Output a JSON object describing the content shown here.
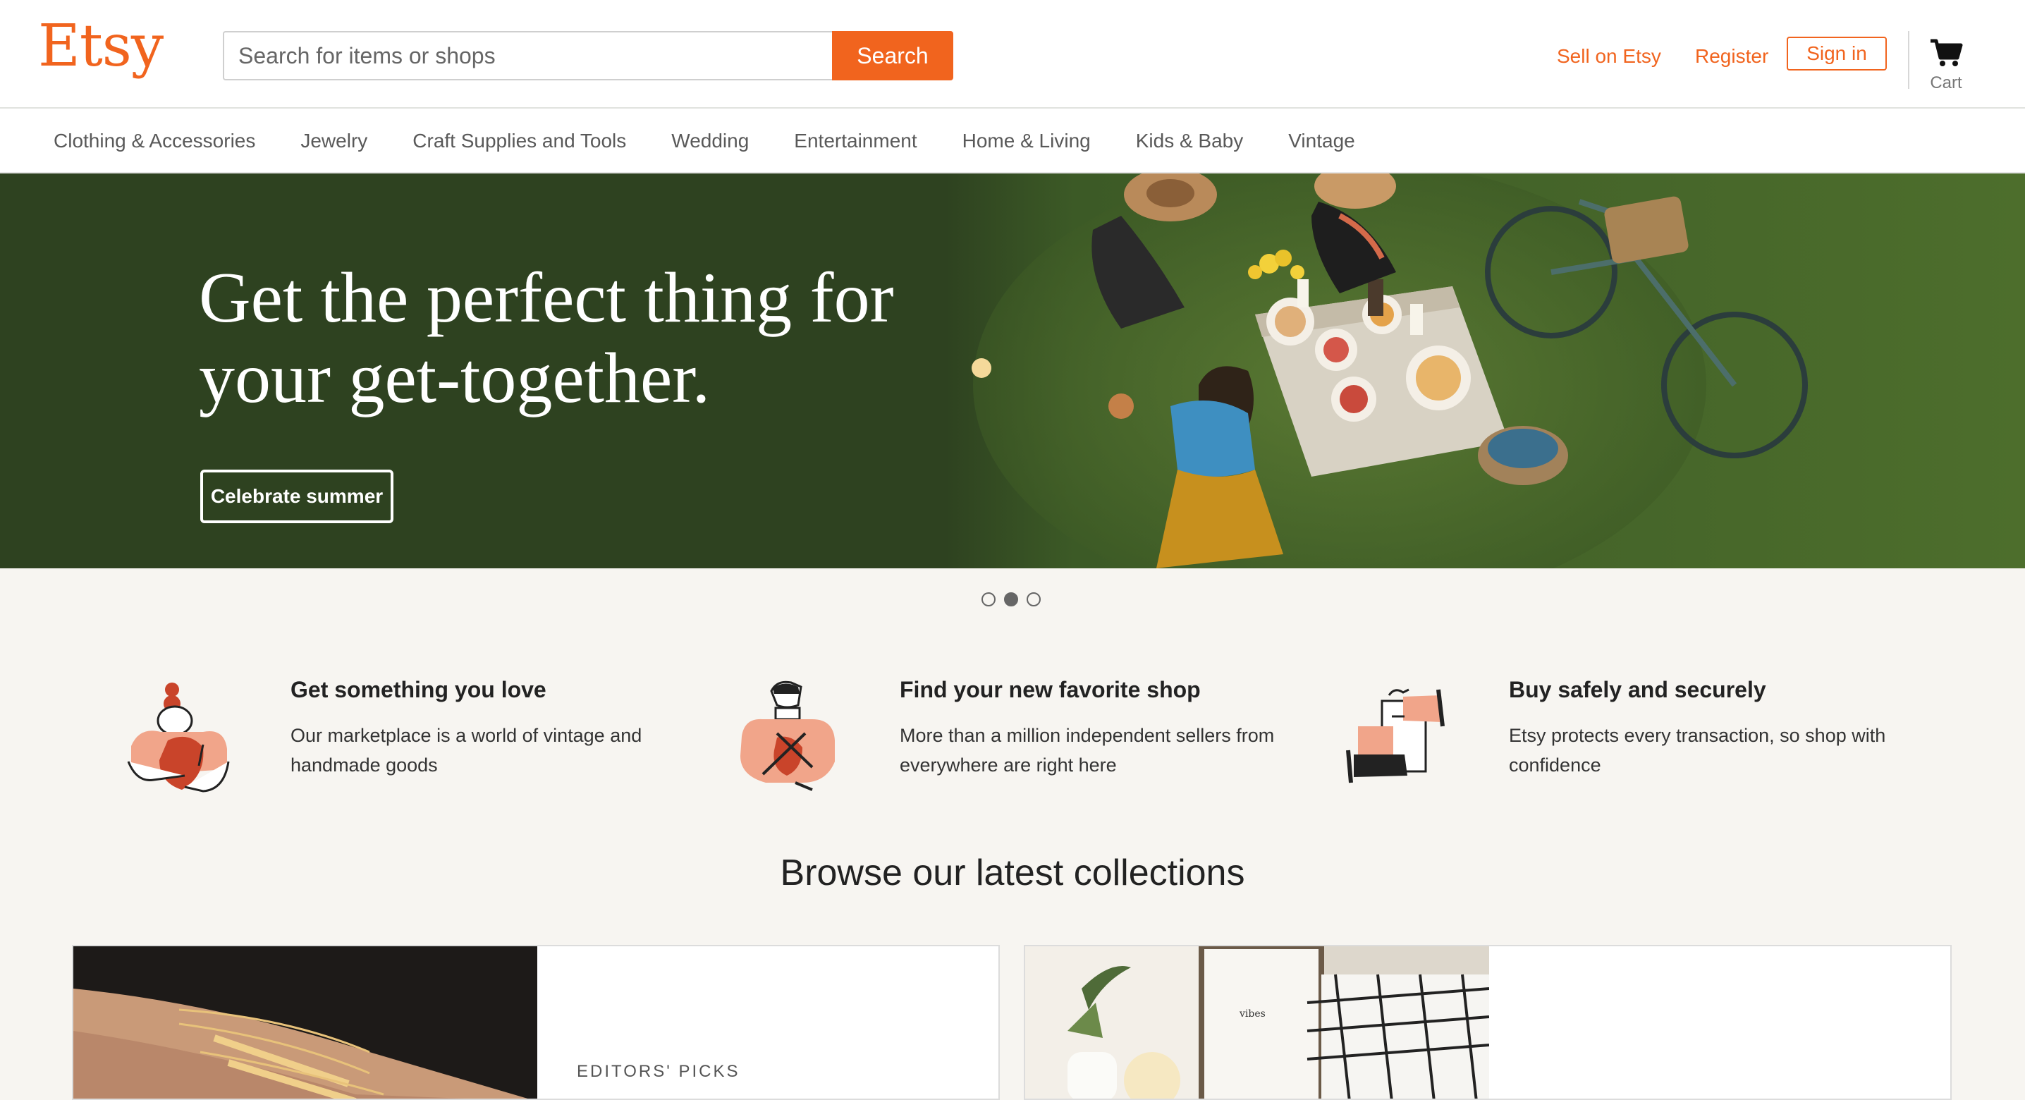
{
  "header": {
    "logo": "Etsy",
    "search_placeholder": "Search for items or shops",
    "search_button": "Search",
    "sell_link": "Sell on Etsy",
    "register_link": "Register",
    "signin_button": "Sign in",
    "cart_label": "Cart",
    "brand_color": "#f1641e"
  },
  "categories": [
    "Clothing & Accessories",
    "Jewelry",
    "Craft Supplies and Tools",
    "Wedding",
    "Entertainment",
    "Home & Living",
    "Kids & Baby",
    "Vintage"
  ],
  "hero": {
    "title": "Get the perfect thing for your get-together.",
    "button": "Celebrate summer",
    "background_color": "#2e4220",
    "slides_total": 3,
    "active_slide": 2
  },
  "values": [
    {
      "icon": "heart-hug-icon",
      "title": "Get something you love",
      "text": "Our marketplace is a world of vintage and handmade goods"
    },
    {
      "icon": "shopkeeper-icon",
      "title": "Find your new favorite shop",
      "text": "More than a million independent sellers from everywhere are right here"
    },
    {
      "icon": "secure-handoff-icon",
      "title": "Buy safely and securely",
      "text": "Etsy protects every transaction, so shop with confidence"
    }
  ],
  "browse": {
    "title": "Browse our latest collections",
    "cards": [
      {
        "image": "gold-bracelets-photo",
        "kicker": "EDITORS' PICKS"
      },
      {
        "image": "home-decor-photo",
        "kicker": ""
      }
    ]
  }
}
